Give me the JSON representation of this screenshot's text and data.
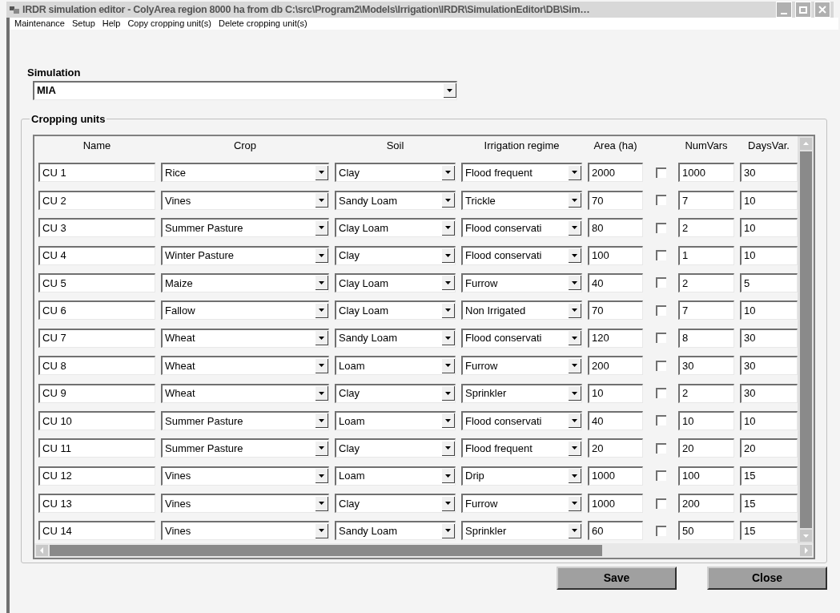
{
  "window": {
    "title": "IRDR simulation editor - ColyArea region 8000 ha   from db C:\\src\\Program2\\Models\\Irrigation\\IRDR\\SimulationEditor\\DB\\Sim…"
  },
  "menu": [
    "Maintenance",
    "Setup",
    "Help",
    "Copy cropping unit(s)",
    "Delete cropping unit(s)"
  ],
  "simulation": {
    "label": "Simulation",
    "value": "MIA"
  },
  "cropping_units": {
    "title": "Cropping units",
    "columns": [
      "Name",
      "Crop",
      "Soil",
      "Irrigation regime",
      "Area (ha)",
      "NumVars",
      "DaysVar."
    ],
    "rows": [
      {
        "name": "CU 1",
        "crop": "Rice",
        "soil": "Clay",
        "irrigation": "Flood frequent",
        "area": "2000",
        "checked": false,
        "num_vars": "1000",
        "days_var": "30"
      },
      {
        "name": "CU 2",
        "crop": "Vines",
        "soil": "Sandy Loam",
        "irrigation": "Trickle",
        "area": "70",
        "checked": false,
        "num_vars": "7",
        "days_var": "10"
      },
      {
        "name": "CU 3",
        "crop": "Summer Pasture",
        "soil": "Clay Loam",
        "irrigation": "Flood conservati",
        "area": "80",
        "checked": false,
        "num_vars": "2",
        "days_var": "10"
      },
      {
        "name": "CU 4",
        "crop": "Winter Pasture",
        "soil": "Clay",
        "irrigation": "Flood conservati",
        "area": "100",
        "checked": false,
        "num_vars": "1",
        "days_var": "10"
      },
      {
        "name": "CU 5",
        "crop": "Maize",
        "soil": "Clay Loam",
        "irrigation": "Furrow",
        "area": "40",
        "checked": false,
        "num_vars": "2",
        "days_var": "5"
      },
      {
        "name": "CU 6",
        "crop": "Fallow",
        "soil": "Clay Loam",
        "irrigation": "Non Irrigated",
        "area": "70",
        "checked": false,
        "num_vars": "7",
        "days_var": "10"
      },
      {
        "name": "CU 7",
        "crop": "Wheat",
        "soil": "Sandy Loam",
        "irrigation": "Flood conservati",
        "area": "120",
        "checked": false,
        "num_vars": "8",
        "days_var": "30"
      },
      {
        "name": "CU 8",
        "crop": "Wheat",
        "soil": "Loam",
        "irrigation": "Furrow",
        "area": "200",
        "checked": false,
        "num_vars": "30",
        "days_var": "30"
      },
      {
        "name": "CU 9",
        "crop": "Wheat",
        "soil": "Clay",
        "irrigation": "Sprinkler",
        "area": "10",
        "checked": false,
        "num_vars": "2",
        "days_var": "30"
      },
      {
        "name": "CU 10",
        "crop": "Summer Pasture",
        "soil": "Loam",
        "irrigation": "Flood conservati",
        "area": "40",
        "checked": false,
        "num_vars": "10",
        "days_var": "10"
      },
      {
        "name": "CU 11",
        "crop": "Summer Pasture",
        "soil": "Clay",
        "irrigation": "Flood frequent",
        "area": "20",
        "checked": false,
        "num_vars": "20",
        "days_var": "20"
      },
      {
        "name": "CU 12",
        "crop": "Vines",
        "soil": "Loam",
        "irrigation": "Drip",
        "area": "1000",
        "checked": false,
        "num_vars": "100",
        "days_var": "15"
      },
      {
        "name": "CU 13",
        "crop": "Vines",
        "soil": "Clay",
        "irrigation": "Furrow",
        "area": "1000",
        "checked": false,
        "num_vars": "200",
        "days_var": "15"
      },
      {
        "name": "CU 14",
        "crop": "Vines",
        "soil": "Sandy Loam",
        "irrigation": "Sprinkler",
        "area": "60",
        "checked": false,
        "num_vars": "50",
        "days_var": "15"
      }
    ]
  },
  "buttons": [
    "Save",
    "Close"
  ]
}
